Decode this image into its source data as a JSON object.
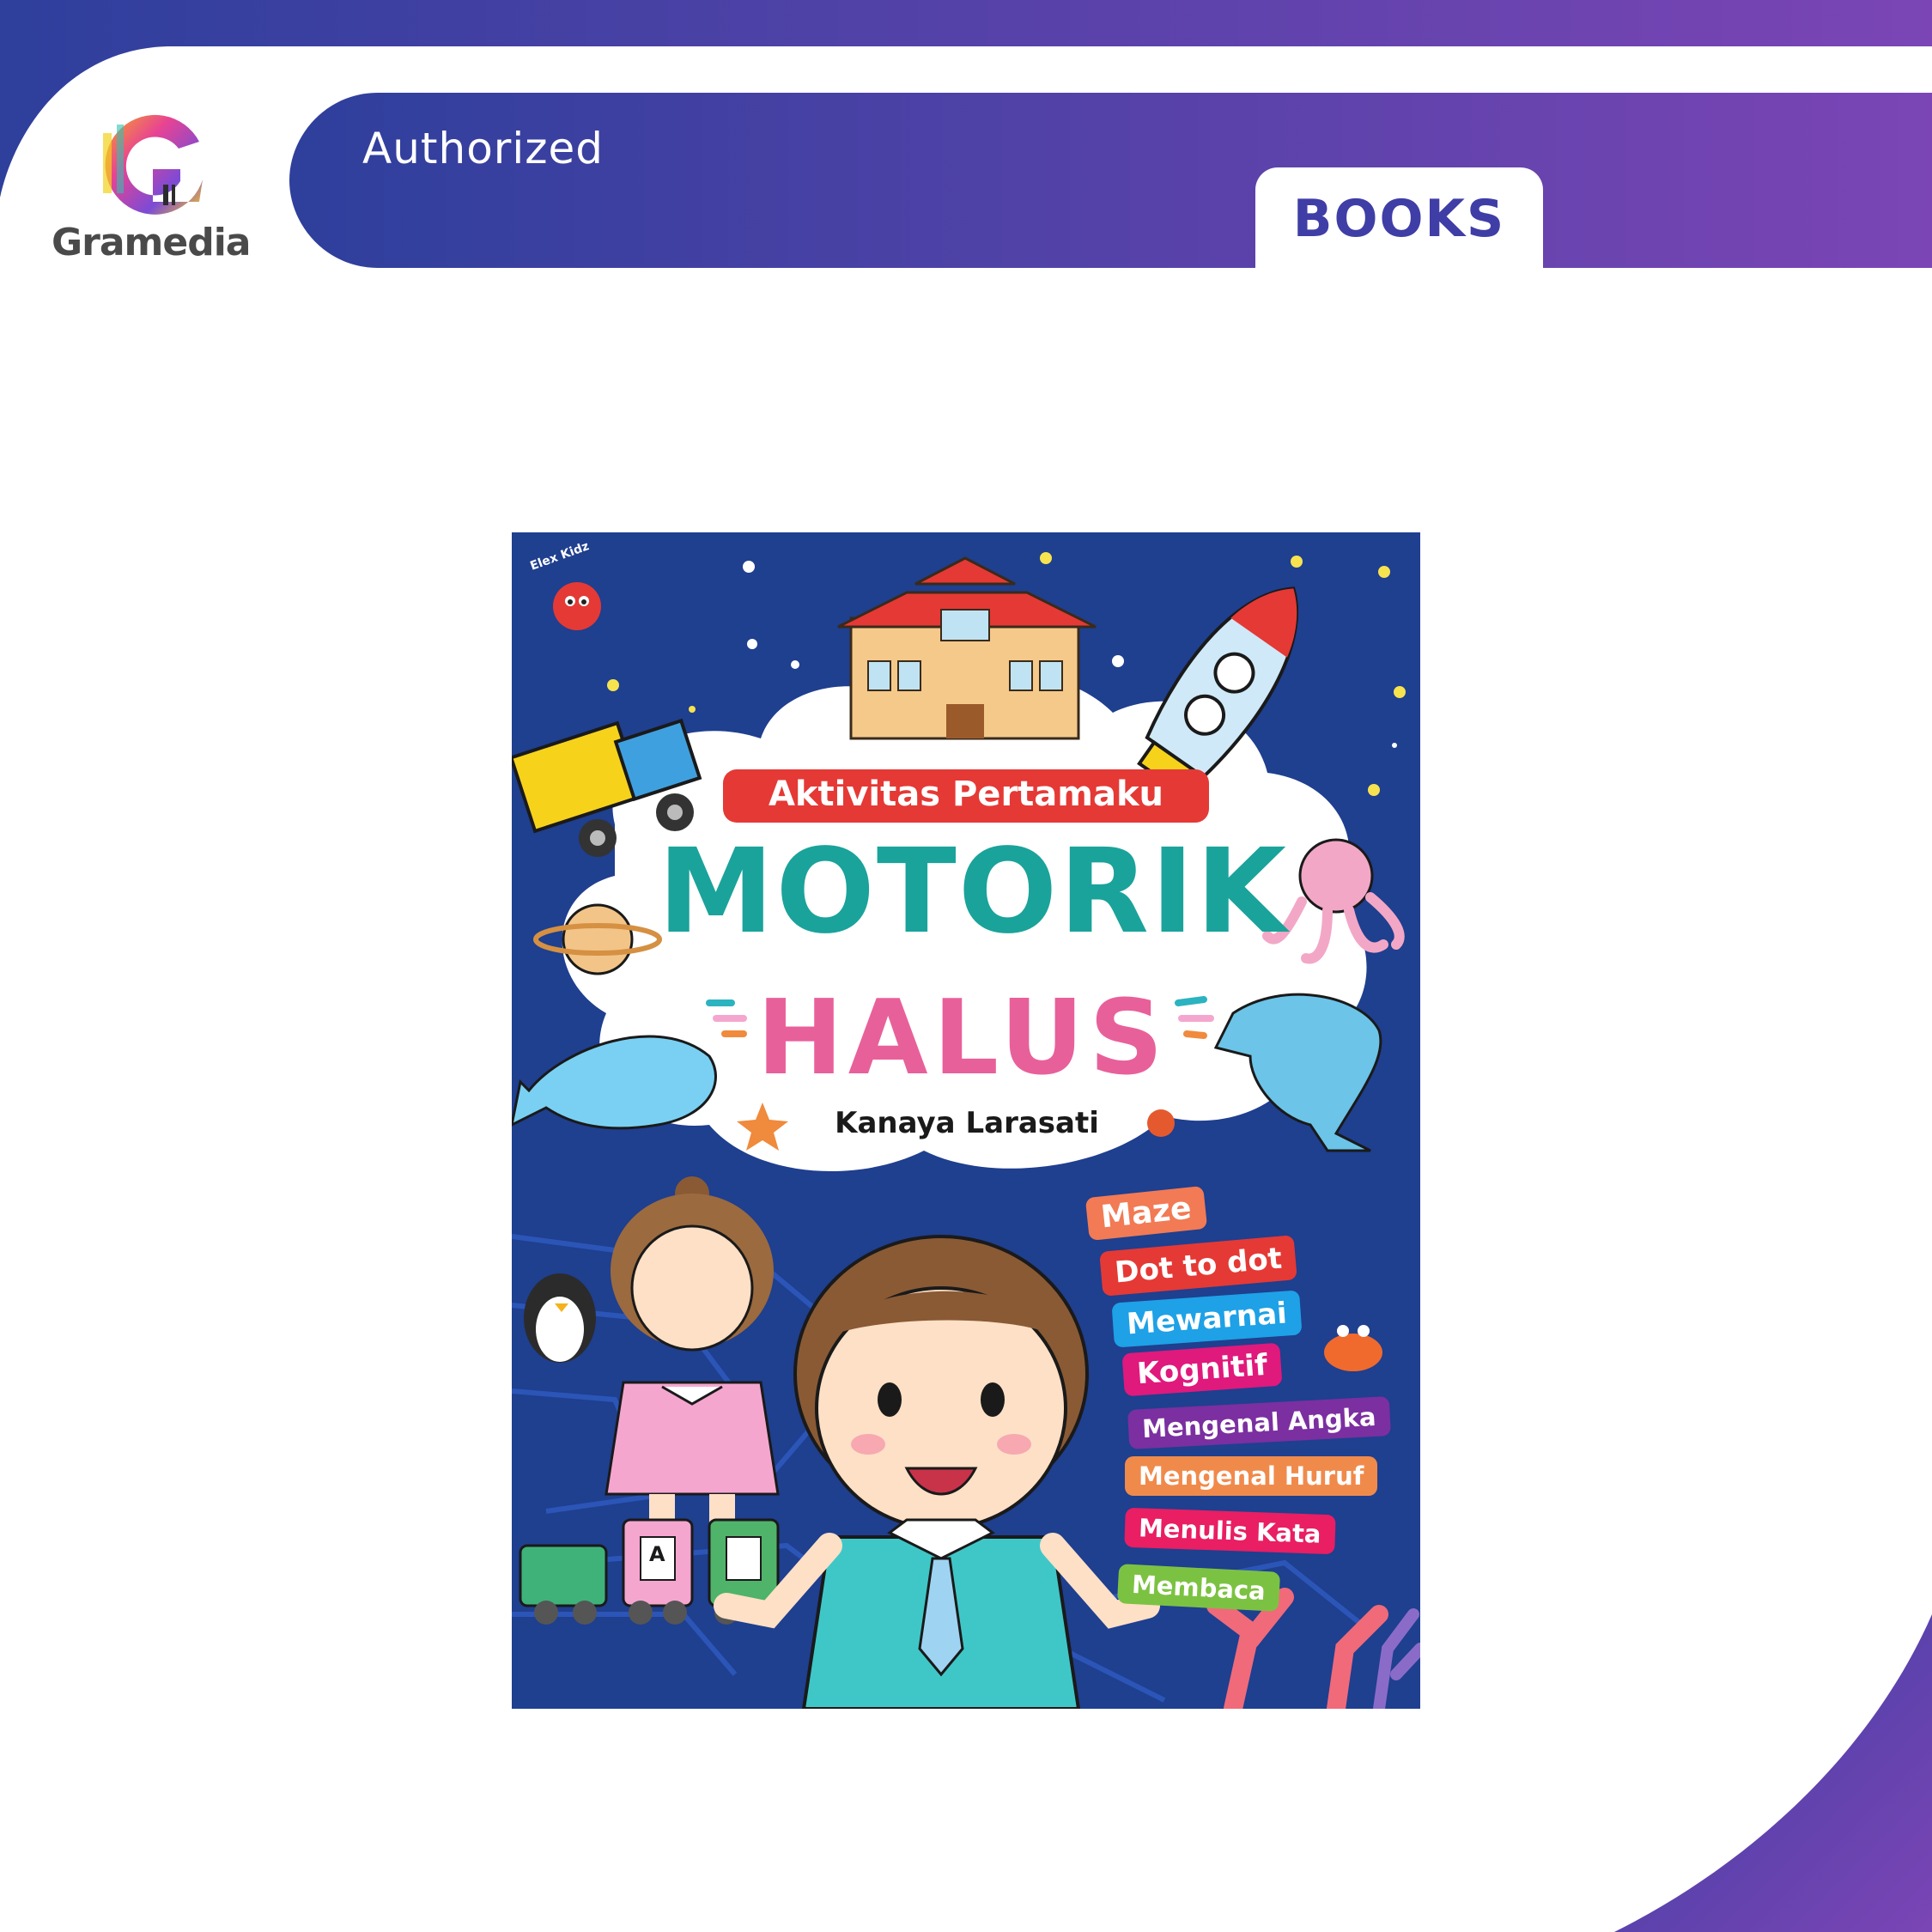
{
  "brand": {
    "name": "Gramedia",
    "authorized": "Authorized",
    "category": "BOOKS"
  },
  "colors": {
    "gradient_start": "#2e3f9c",
    "gradient_end": "#7b45b5",
    "books_text": "#3f3ea6",
    "cover_bg": "#1f3f8f"
  },
  "cover": {
    "publisher": "Elex Kidz",
    "series": "Aktivitas Pertamaku",
    "title_line1": "MOTORIK",
    "title_line2": "HALUS",
    "author": "Kanaya Larasati",
    "train_letter": "A",
    "activities": [
      {
        "label": "Maze",
        "color": "#f27a54"
      },
      {
        "label": "Dot to dot",
        "color": "#e53935"
      },
      {
        "label": "Mewarnai",
        "color": "#1ea1e6"
      },
      {
        "label": "Kognitif",
        "color": "#e0197d"
      },
      {
        "label": "Mengenal Angka",
        "color": "#7b2fa0"
      },
      {
        "label": "Mengenal Huruf",
        "color": "#f08a4b"
      },
      {
        "label": "Menulis Kata",
        "color": "#e91e63"
      },
      {
        "label": "Membaca",
        "color": "#7cc242"
      }
    ]
  }
}
